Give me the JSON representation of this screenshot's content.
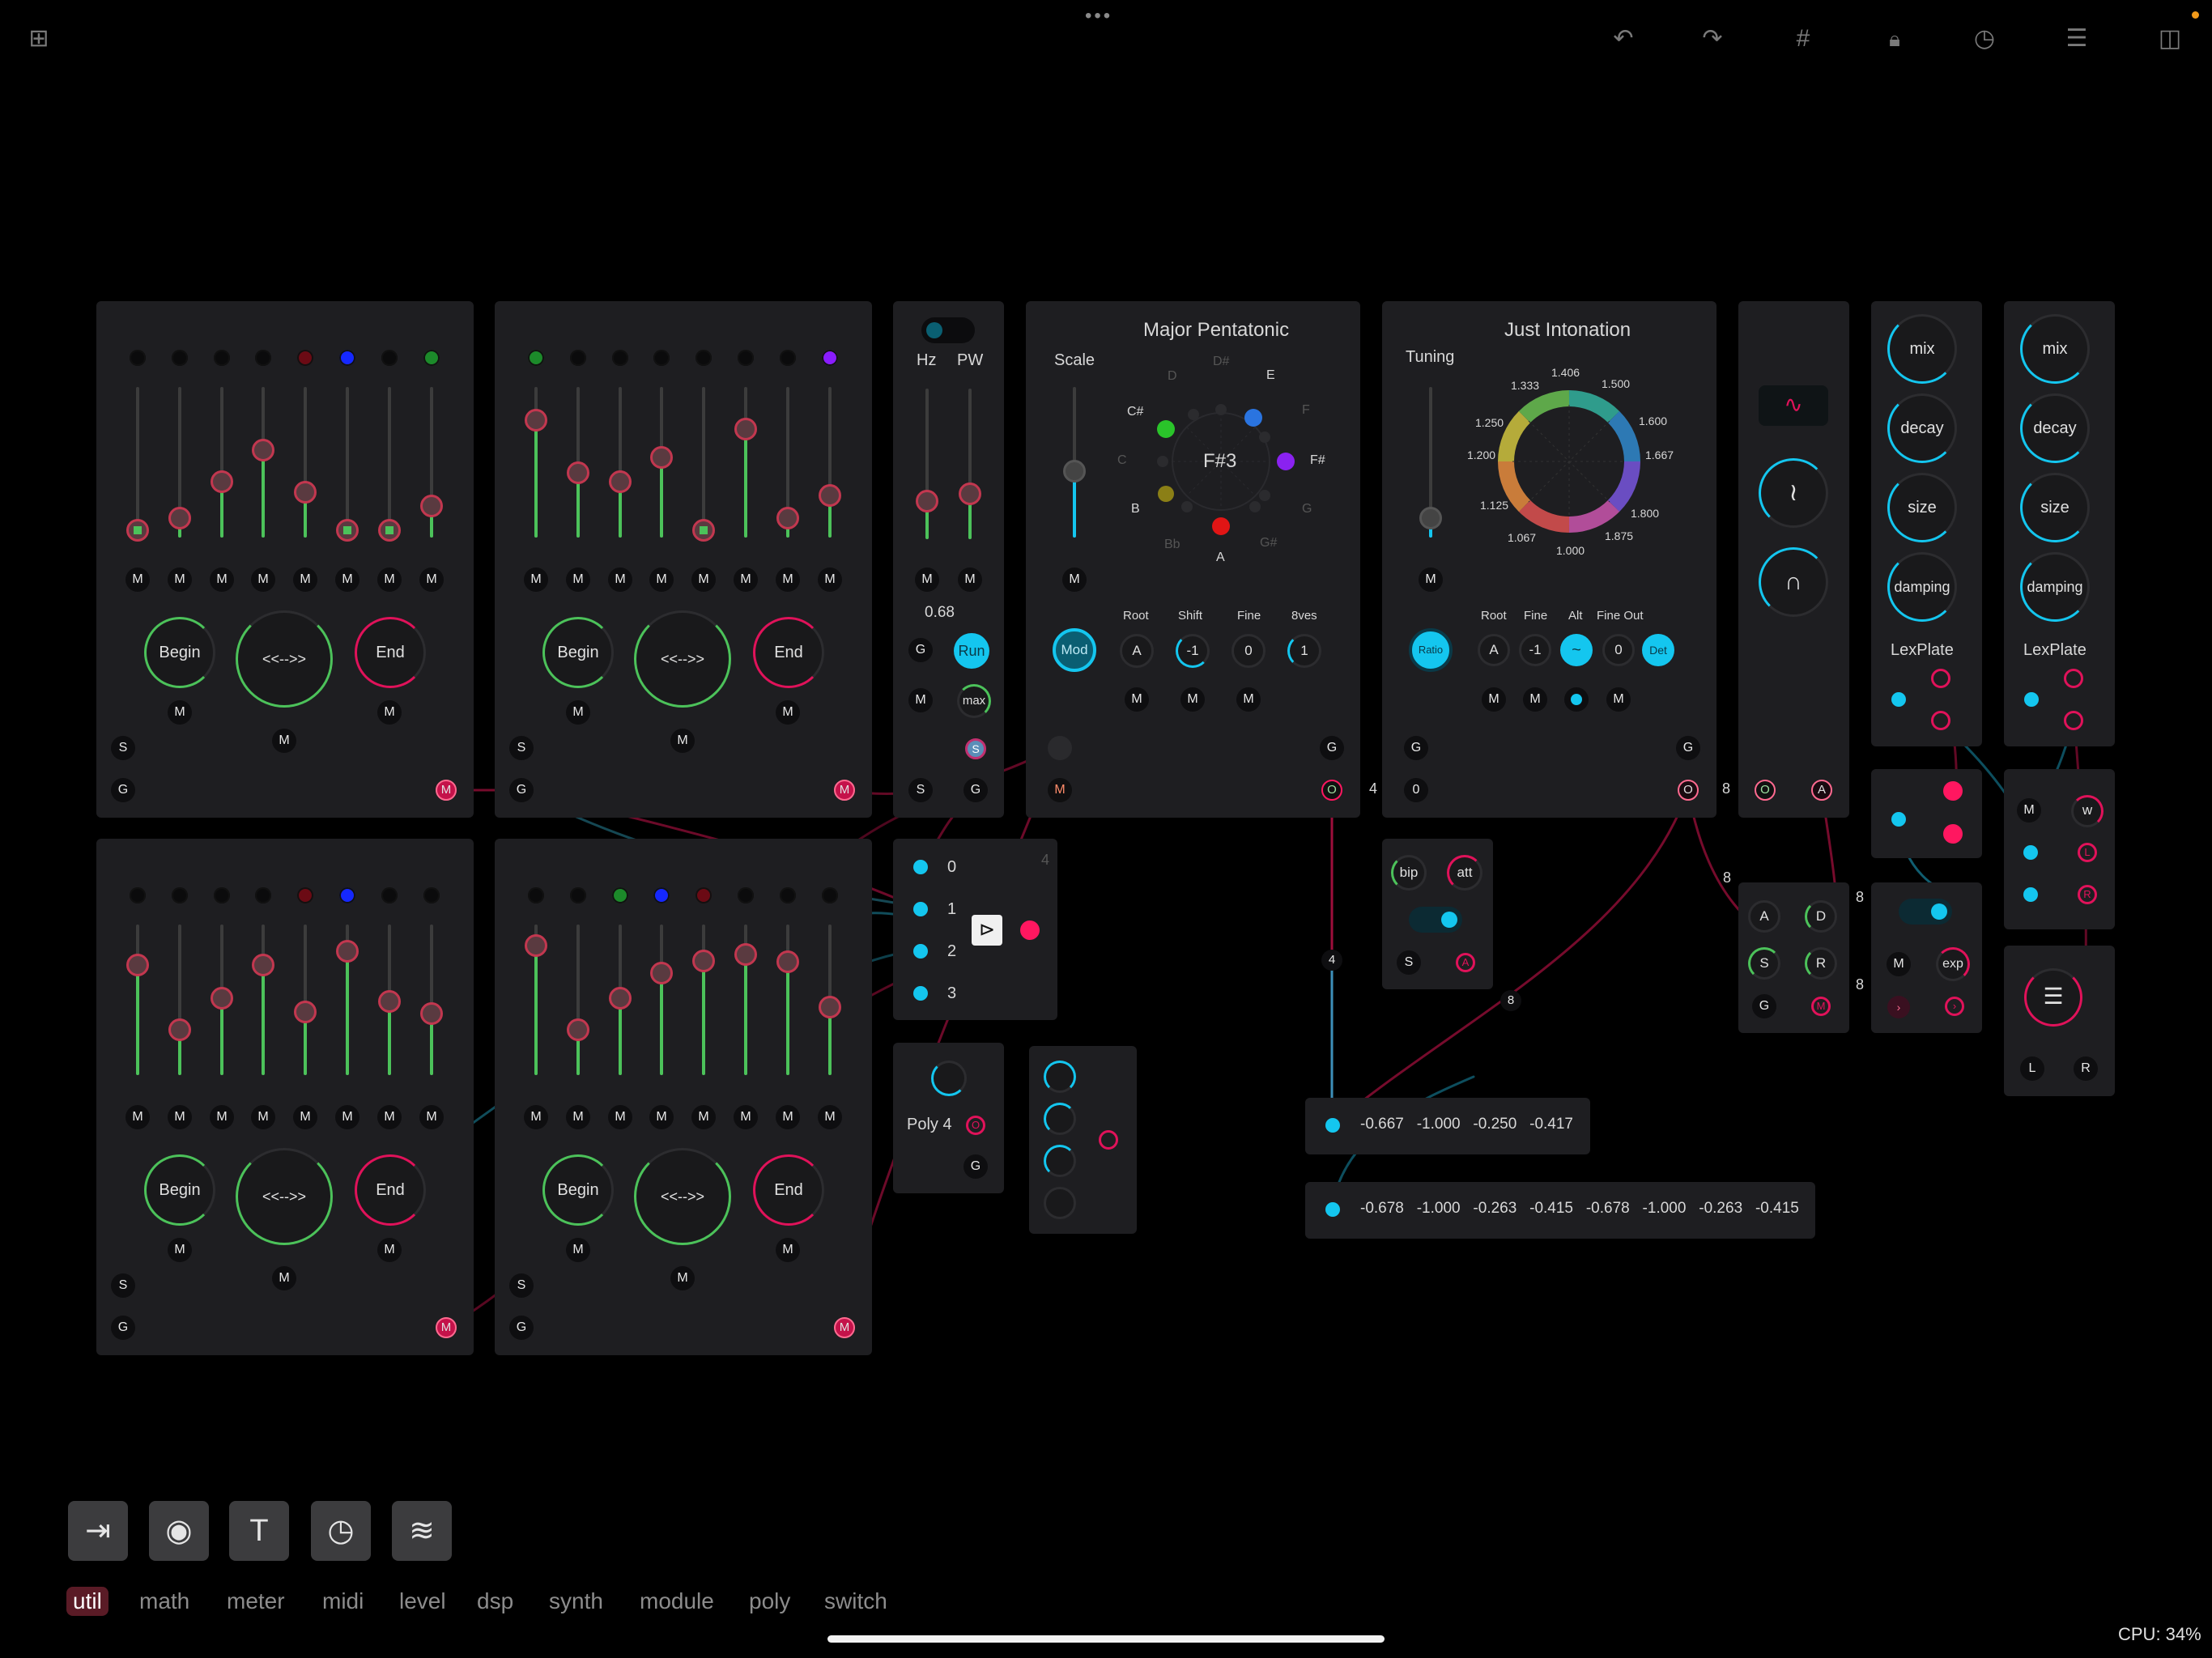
{
  "topbar": {
    "grid_icon": "grid-icon",
    "more_icon": "more-dots-icon",
    "more_label": "•••",
    "undo_icon": "undo-icon",
    "redo_icon": "redo-icon",
    "hash_icon": "hash-grid-icon",
    "lock_icon": "lock-icon",
    "clock_icon": "clock-icon",
    "sliders_icon": "sliders-icon",
    "sidebar_icon": "sidebar-icon"
  },
  "sequencers": [
    {
      "leds": [
        "#0b0b0c",
        "#0b0b0c",
        "#0b0b0c",
        "#0b0b0c",
        "#6b0a14",
        "#1528ff",
        "#0b0b0c",
        "#1c8a2a"
      ],
      "values": [
        0.05,
        0.13,
        0.37,
        0.58,
        0.3,
        0.05,
        0.05,
        0.21
      ],
      "m_labels": [
        "M",
        "M",
        "M",
        "M",
        "M",
        "M",
        "M",
        "M"
      ],
      "begin_label": "Begin",
      "dir_label": "<<-->>",
      "end_label": "End",
      "m_begin": "M",
      "m_dir": "M",
      "m_end": "M",
      "s_label": "S",
      "g_label": "G",
      "out_label": "M"
    },
    {
      "leds": [
        "#1c8a2a",
        "#0b0b0c",
        "#0b0b0c",
        "#0b0b0c",
        "#0b0b0c",
        "#0b0b0c",
        "#0b0b0c",
        "#8a1cff"
      ],
      "values": [
        0.78,
        0.43,
        0.37,
        0.53,
        0.05,
        0.72,
        0.13,
        0.28
      ],
      "m_labels": [
        "M",
        "M",
        "M",
        "M",
        "M",
        "M",
        "M",
        "M"
      ],
      "begin_label": "Begin",
      "dir_label": "<<-->>",
      "end_label": "End",
      "m_begin": "M",
      "m_dir": "M",
      "m_end": "M",
      "s_label": "S",
      "g_label": "G",
      "out_label": "M"
    },
    {
      "leds": [
        "#0b0b0c",
        "#0b0b0c",
        "#0b0b0c",
        "#0b0b0c",
        "#6b0a14",
        "#1528ff",
        "#0b0b0c",
        "#0b0b0c"
      ],
      "values": [
        0.73,
        0.3,
        0.51,
        0.73,
        0.42,
        0.82,
        0.49,
        0.41
      ],
      "m_labels": [
        "M",
        "M",
        "M",
        "M",
        "M",
        "M",
        "M",
        "M"
      ],
      "begin_label": "Begin",
      "dir_label": "<<-->>",
      "end_label": "End",
      "m_begin": "M",
      "m_dir": "M",
      "m_end": "M",
      "s_label": "S",
      "g_label": "G",
      "out_label": "M"
    },
    {
      "leds": [
        "#0b0b0c",
        "#0b0b0c",
        "#1c8a2a",
        "#1528ff",
        "#6b0a14",
        "#0b0b0c",
        "#0b0b0c",
        "#0b0b0c"
      ],
      "values": [
        0.86,
        0.3,
        0.51,
        0.68,
        0.76,
        0.8,
        0.75,
        0.45
      ],
      "m_labels": [
        "M",
        "M",
        "M",
        "M",
        "M",
        "M",
        "M",
        "M"
      ],
      "begin_label": "Begin",
      "dir_label": "<<-->>",
      "end_label": "End",
      "m_begin": "M",
      "m_dir": "M",
      "m_end": "M",
      "s_label": "S",
      "g_label": "G",
      "out_label": "M"
    }
  ],
  "clock": {
    "hz_label": "Hz",
    "pw_label": "PW",
    "hz_value": 0.25,
    "pw_value": 0.3,
    "value_text": "0.68",
    "g_label": "G",
    "run_label": "Run",
    "m_label": "M",
    "max_label": "max",
    "s_label": "S",
    "g2_label": "G",
    "m_hz": "M",
    "m_pw": "M"
  },
  "scale": {
    "title": "Major Pentatonic",
    "scale_label": "Scale",
    "center_note": "F#3",
    "notes": [
      "D#",
      "E",
      "F",
      "F#",
      "G",
      "G#",
      "A",
      "Bb",
      "B",
      "C",
      "C#",
      "D"
    ],
    "mod_label": "Mod",
    "root_label": "Root",
    "shift_label": "Shift",
    "fine_label": "Fine",
    "8ves_label": "8ves",
    "root_value": "A",
    "shift_value": "-1",
    "fine_value": "0",
    "8ves_value": "1",
    "m_scale": "M",
    "m1": "M",
    "m2": "M",
    "m3": "M",
    "m_out": "M",
    "g_label": "G",
    "o_label": "O",
    "four_label": "4"
  },
  "tuning": {
    "title": "Just Intonation",
    "tuning_label": "Tuning",
    "ratios": [
      "1.406",
      "1.500",
      "1.600",
      "1.667",
      "1.800",
      "1.875",
      "1.000",
      "1.067",
      "1.125",
      "1.200",
      "1.250",
      "1.333"
    ],
    "ratio_label": "Ratio",
    "root_label": "Root",
    "fine_label": "Fine",
    "alt_label": "Alt",
    "fine_out_label": "Fine Out",
    "root_value": "A",
    "fine_value": "-1",
    "alt_value": "~",
    "fine_out_value": "0",
    "det_label": "Det",
    "m_tuning": "M",
    "m1": "M",
    "m2": "M",
    "m3": "M",
    "g_label": "G",
    "g2_label": "G",
    "zero_label": "0",
    "o_label": "O",
    "eight_label": "8"
  },
  "osc": {
    "wave_icon": "sine-wave-icon",
    "o_label": "O",
    "a_label": "A"
  },
  "reverbs": [
    {
      "mix": "mix",
      "decay": "decay",
      "size": "size",
      "damping": "damping",
      "name": "LexPlate"
    },
    {
      "mix": "mix",
      "decay": "decay",
      "size": "size",
      "damping": "damping",
      "name": "LexPlate"
    }
  ],
  "router": {
    "inputs": [
      "0",
      "1",
      "2",
      "3"
    ],
    "four_label": "4",
    "switch_icon": "merge-icon"
  },
  "bip": {
    "bip_label": "bip",
    "att_label": "att",
    "s_label": "S",
    "a_label": "A"
  },
  "adsr": {
    "a": "A",
    "d": "D",
    "s": "S",
    "r": "R",
    "g": "G",
    "m": "M",
    "eight": "8"
  },
  "vca": {
    "m_label": "M",
    "exp_label": "exp",
    "eight": "8"
  },
  "mixer": {
    "m_label": "M",
    "w_label": "w",
    "l_label": "L",
    "r_label": "R"
  },
  "stereo": {
    "l_label": "L",
    "r_label": "R"
  },
  "poly": {
    "label": "Poly 4",
    "o_label": "O",
    "g_label": "G"
  },
  "values_a": {
    "text": "-0.667   -1.000   -0.250   -0.417"
  },
  "values_b": {
    "text": "-0.678   -1.000   -0.263   -0.415   -0.678   -1.000   -0.263   -0.415"
  },
  "cable_labels": [
    "4",
    "8",
    "8",
    "8",
    "8"
  ],
  "toolbar": {
    "tools": [
      {
        "icon": "input-icon",
        "glyph": "⇥"
      },
      {
        "icon": "camera-icon",
        "glyph": "◉"
      },
      {
        "icon": "text-icon",
        "glyph": "T"
      },
      {
        "icon": "clock-icon",
        "glyph": "◷"
      },
      {
        "icon": "filter-icon",
        "glyph": "≋"
      }
    ],
    "categories": [
      "util",
      "math",
      "meter",
      "midi",
      "level",
      "dsp",
      "synth",
      "module",
      "poly",
      "switch"
    ],
    "selected": "util"
  },
  "status": {
    "cpu": "CPU: 34%"
  },
  "colors": {
    "accent_cyan": "#14c6ef",
    "accent_pink": "#ff1760",
    "accent_green": "#4cc25a",
    "panel": "#1e1e21"
  }
}
